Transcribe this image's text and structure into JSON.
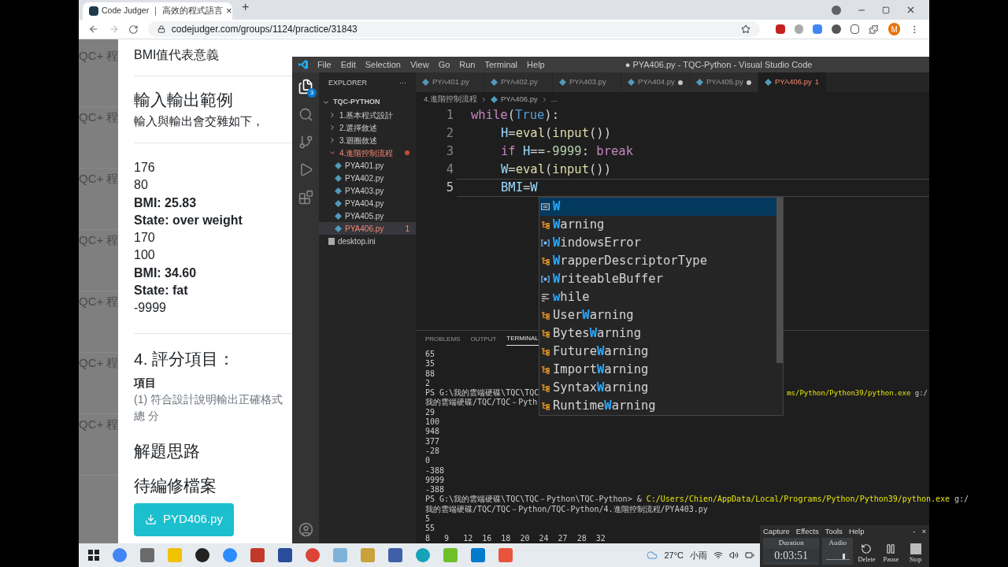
{
  "browser": {
    "tab_title": "Code Judger ｜ 高效的程式語言",
    "tab_close": "×",
    "new_tab": "+",
    "url": "codejudger.com/groups/1124/practice/31843",
    "avatar": "M"
  },
  "page": {
    "side_labels": [
      "QC+ 程",
      "QC+ 程",
      "QC+ 程",
      "QC+ 程",
      "QC+ 程",
      "QC+ 程",
      "QC+ 程"
    ],
    "meaning": "BMI值代表意義",
    "io_title": "輸入輸出範例",
    "io_desc": "輸入與輸出會交雜如下，",
    "sample": [
      {
        "text": "176",
        "bold": false
      },
      {
        "text": "80",
        "bold": false
      },
      {
        "text": "BMI: 25.83",
        "bold": true
      },
      {
        "text": "State: over weight",
        "bold": true
      },
      {
        "text": "170",
        "bold": false
      },
      {
        "text": "100",
        "bold": false
      },
      {
        "text": "BMI: 34.60",
        "bold": true
      },
      {
        "text": "State: fat",
        "bold": true
      },
      {
        "text": "-9999",
        "bold": false
      }
    ],
    "score_title": "4. 評分項目：",
    "score_head": "項目",
    "score_item": "(1) 符合設計說明輸出正確格式",
    "score_total": "總 分",
    "hint_title": "解題思路",
    "file_title": "待編修檔案",
    "download": "PYD406.py"
  },
  "vscode": {
    "menu": [
      "File",
      "Edit",
      "Selection",
      "View",
      "Go",
      "Run",
      "Terminal",
      "Help"
    ],
    "title": "● PYA406.py - TQC-Python - Visual Studio Code",
    "explorer_badge": "3",
    "explorer_title": "EXPLORER",
    "explorer_more": "···",
    "root": "TQC-PYTHON",
    "tree": [
      {
        "label": "1.基本程式設計",
        "folder": true,
        "expanded": false,
        "error": false,
        "selected": false
      },
      {
        "label": "2.選擇敘述",
        "folder": true,
        "expanded": false,
        "error": false,
        "selected": false
      },
      {
        "label": "3.迴圈敘述",
        "folder": true,
        "expanded": false,
        "error": false,
        "selected": false
      },
      {
        "label": "4.進階控制流程",
        "folder": true,
        "expanded": true,
        "error": true,
        "selected": false,
        "children": [
          {
            "label": "PYA401.py",
            "folder": false,
            "error": false,
            "selected": false
          },
          {
            "label": "PYA402.py",
            "folder": false,
            "error": false,
            "selected": false
          },
          {
            "label": "PYA403.py",
            "folder": false,
            "error": false,
            "selected": false
          },
          {
            "label": "PYA404.py",
            "folder": false,
            "error": false,
            "selected": false
          },
          {
            "label": "PYA405.py",
            "folder": false,
            "error": false,
            "selected": false
          },
          {
            "label": "PYA406.py",
            "folder": false,
            "error": true,
            "selected": true,
            "badge": "1"
          }
        ]
      },
      {
        "label": "desktop.ini",
        "folder": false,
        "error": false,
        "selected": false,
        "kind": "ini"
      }
    ],
    "tabs": [
      {
        "label": "PYA401.py",
        "modified": false,
        "selected": false
      },
      {
        "label": "PYA402.py",
        "modified": false,
        "selected": false
      },
      {
        "label": "PYA403.py",
        "modified": false,
        "selected": false
      },
      {
        "label": "PYA404.py",
        "modified": true,
        "selected": false
      },
      {
        "label": "PYA405.py",
        "modified": true,
        "selected": false
      },
      {
        "label": "PYA406.py",
        "modified": true,
        "selected": true,
        "errors": "1"
      }
    ],
    "breadcrumb": [
      "4.進階控制流程",
      "PYA406.py",
      "..."
    ],
    "code": [
      {
        "number": "1",
        "current": false,
        "tokens": [
          {
            "kind": "keyword",
            "text": "while"
          },
          {
            "kind": "plain",
            "text": "("
          },
          {
            "kind": "constant",
            "text": "True"
          },
          {
            "kind": "plain",
            "text": "):"
          }
        ],
        "children": [
          {
            "number": "2",
            "current": false,
            "tokens": [
              {
                "kind": "var",
                "text": "H"
              },
              {
                "kind": "plain",
                "text": "="
              },
              {
                "kind": "func",
                "text": "eval"
              },
              {
                "kind": "plain",
                "text": "("
              },
              {
                "kind": "func",
                "text": "input"
              },
              {
                "kind": "plain",
                "text": "())"
              }
            ]
          },
          {
            "number": "3",
            "current": false,
            "tokens": [
              {
                "kind": "keyword",
                "text": "if "
              },
              {
                "kind": "var",
                "text": "H"
              },
              {
                "kind": "plain",
                "text": "=="
              },
              {
                "kind": "number",
                "text": "-9999"
              },
              {
                "kind": "plain",
                "text": ": "
              },
              {
                "kind": "keyword",
                "text": "break"
              }
            ]
          },
          {
            "number": "4",
            "current": false,
            "tokens": [
              {
                "kind": "var",
                "text": "W"
              },
              {
                "kind": "plain",
                "text": "="
              },
              {
                "kind": "func",
                "text": "eval"
              },
              {
                "kind": "plain",
                "text": "("
              },
              {
                "kind": "func",
                "text": "input"
              },
              {
                "kind": "plain",
                "text": "())"
              }
            ]
          },
          {
            "number": "5",
            "current": true,
            "tokens": [
              {
                "kind": "var",
                "text": "BMI"
              },
              {
                "kind": "plain",
                "text": "="
              },
              {
                "kind": "var",
                "text": "W"
              }
            ]
          }
        ]
      }
    ],
    "suggestions": [
      {
        "kind": "text",
        "match": "W",
        "selected": true
      },
      {
        "kind": "class",
        "match": "W",
        "after": "arning",
        "selected": false
      },
      {
        "kind": "variable",
        "match": "W",
        "after": "indowsError",
        "selected": false
      },
      {
        "kind": "class",
        "match": "W",
        "after": "rapperDescriptorType",
        "selected": false
      },
      {
        "kind": "variable",
        "match": "W",
        "after": "riteableBuffer",
        "selected": false
      },
      {
        "kind": "keyword",
        "match": "w",
        "after": "hile",
        "selected": false
      },
      {
        "kind": "class",
        "before": "User",
        "match": "W",
        "after": "arning",
        "selected": false
      },
      {
        "kind": "class",
        "before": "Bytes",
        "match": "W",
        "after": "arning",
        "selected": false
      },
      {
        "kind": "class",
        "before": "Future",
        "match": "W",
        "after": "arning",
        "selected": false
      },
      {
        "kind": "class",
        "before": "Import",
        "match": "W",
        "after": "arning",
        "selected": false
      },
      {
        "kind": "class",
        "before": "Syntax",
        "match": "W",
        "after": "arning",
        "selected": false
      },
      {
        "kind": "class",
        "before": "Runtime",
        "match": "W",
        "after": "arning",
        "selected": false
      }
    ],
    "panel_tabs": [
      {
        "label": "PROBLEMS",
        "selected": false
      },
      {
        "label": "OUTPUT",
        "selected": false
      },
      {
        "label": "TERMINAL",
        "selected": true
      }
    ],
    "terminal": [
      {
        "text": "65"
      },
      {
        "text": "35"
      },
      {
        "text": "88"
      },
      {
        "text": "2"
      },
      {
        "text": "PS G:\\我的雲端硬碟\\TQC\\TQC",
        "right_path": "ms/Python/Python39/python.exe",
        "right_after": " g:/"
      },
      {
        "text": "我的雲端硬碟/TQC/TQC－Pyth"
      },
      {
        "text": "29"
      },
      {
        "text": "100"
      },
      {
        "text": "948"
      },
      {
        "text": "377"
      },
      {
        "text": "-28"
      },
      {
        "text": "0"
      },
      {
        "text": "-388"
      },
      {
        "text": "9999"
      },
      {
        "text": "-388"
      },
      {
        "text": "PS G:\\我的雲端硬碟\\TQC\\TQC－Python\\TQC-Python> & ",
        "path": "C:/Users/Chien/AppData/Local/Programs/Python/Python39/python.exe",
        "after": " g:/"
      },
      {
        "text": "我的雲端硬碟/TQC/TQC－Python/TQC-Python/4.進階控制流程/PYA403.py"
      },
      {
        "text": "5"
      },
      {
        "text": "55"
      },
      {
        "text": "8   9   12  16  18  20  24  27  28  32"
      }
    ]
  },
  "taskbar": {
    "apps": [
      {
        "kind": "circle",
        "color": "#4285f4"
      },
      {
        "kind": "square",
        "color": "#6b6b6b"
      },
      {
        "kind": "square",
        "color": "#f2c100"
      },
      {
        "kind": "circle",
        "color": "#222222"
      },
      {
        "kind": "circle",
        "color": "#2d8cff"
      },
      {
        "kind": "square",
        "color": "#c0392b"
      },
      {
        "kind": "square",
        "color": "#2a4d9b"
      },
      {
        "kind": "circle",
        "color": "#db4437"
      },
      {
        "kind": "square",
        "color": "#7fb2d9"
      },
      {
        "kind": "square",
        "color": "#c9a23c"
      },
      {
        "kind": "square",
        "color": "#3f5fa8"
      },
      {
        "kind": "circle",
        "color": "#16a3b8"
      },
      {
        "kind": "square",
        "color": "#6fbf2b"
      },
      {
        "kind": "square",
        "color": "#007acc"
      },
      {
        "kind": "square",
        "color": "#e8543c"
      }
    ],
    "temperature": "27°C",
    "weather": "小雨"
  },
  "recorder": {
    "menu": [
      "Capture",
      "Effects",
      "Tools",
      "Help"
    ],
    "minimize": "-",
    "close": "×",
    "duration_label": "Duration",
    "duration": "0:03:51",
    "audio_label": "Audio",
    "audio": {
      "level": 0.8
    },
    "buttons": [
      {
        "kind": "delete",
        "label": "Delete"
      },
      {
        "kind": "pause",
        "label": "Pause"
      },
      {
        "kind": "stop",
        "label": "Stop"
      }
    ]
  }
}
